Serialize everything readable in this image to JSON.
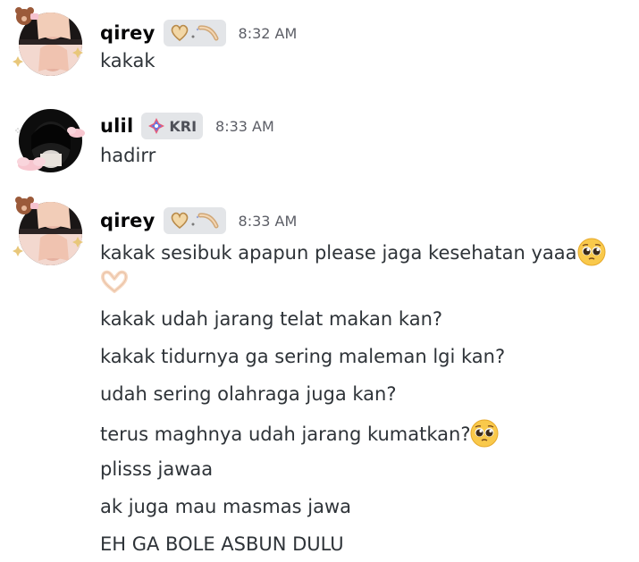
{
  "messages": [
    {
      "username": "qirey",
      "timestamp": "8:32 AM",
      "lines": [
        "kakak"
      ]
    },
    {
      "username": "ulil",
      "tag": "KRI",
      "timestamp": "8:33 AM",
      "lines": [
        "hadirr"
      ]
    },
    {
      "username": "qirey",
      "timestamp": "8:33 AM",
      "lines": [
        "kakak sesibuk apapun please jaga kesehatan yaaa",
        "kakak udah jarang telat makan kan?",
        "kakak tidurnya ga sering maleman lgi kan?",
        "udah sering olahraga juga kan?",
        "terus maghnya udah jarang kumatkan?",
        "plisss jawaa",
        "ak juga mau masmas jawa",
        "EH GA BOLE ASBUN DULU"
      ]
    }
  ],
  "icons": {
    "pleading_face": "pleading-face-icon",
    "heart_hands": "heart-hands-icon",
    "heart_ring_badge": "heart-ring-badge-icon",
    "sparkle_diamond_badge": "sparkle-diamond-badge-icon"
  },
  "colors": {
    "username": "#060607",
    "text": "#2e3338",
    "timestamp": "#5c5e66",
    "tag_bg": "#e3e5e8"
  }
}
